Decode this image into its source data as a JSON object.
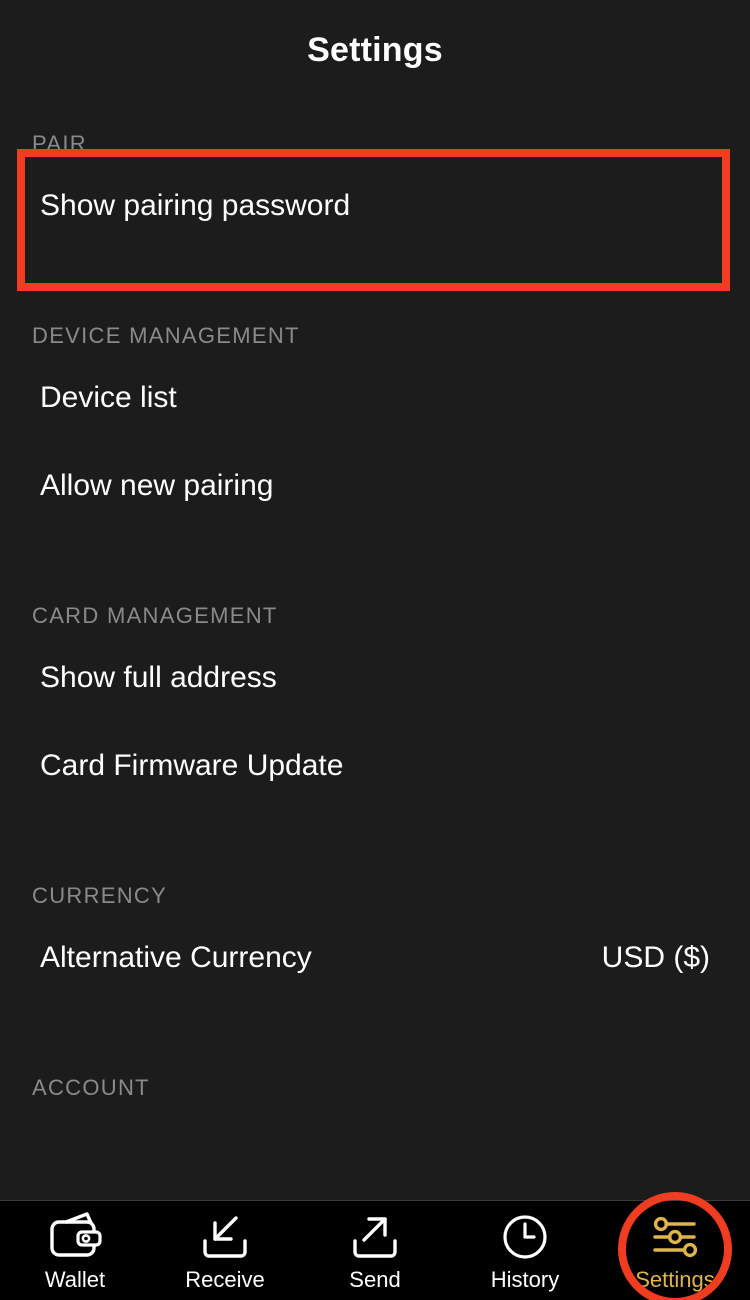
{
  "header": {
    "title": "Settings"
  },
  "sections": [
    {
      "id": "pair",
      "header": "PAIR",
      "rows": [
        {
          "id": "show-pairing-password",
          "label": "Show pairing password",
          "value": ""
        }
      ]
    },
    {
      "id": "device-management",
      "header": "DEVICE MANAGEMENT",
      "rows": [
        {
          "id": "device-list",
          "label": "Device list",
          "value": ""
        },
        {
          "id": "allow-new-pairing",
          "label": "Allow new pairing",
          "value": ""
        }
      ]
    },
    {
      "id": "card-management",
      "header": "CARD MANAGEMENT",
      "rows": [
        {
          "id": "show-full-address",
          "label": "Show full address",
          "value": ""
        },
        {
          "id": "card-firmware-update",
          "label": "Card Firmware Update",
          "value": ""
        }
      ]
    },
    {
      "id": "currency",
      "header": "CURRENCY",
      "rows": [
        {
          "id": "alternative-currency",
          "label": "Alternative Currency",
          "value": "USD ($)"
        }
      ]
    },
    {
      "id": "account",
      "header": "ACCOUNT",
      "rows": []
    }
  ],
  "tabbar": {
    "tabs": [
      {
        "id": "wallet",
        "label": "Wallet",
        "icon": "wallet-icon",
        "active": false
      },
      {
        "id": "receive",
        "label": "Receive",
        "icon": "receive-icon",
        "active": false
      },
      {
        "id": "send",
        "label": "Send",
        "icon": "send-icon",
        "active": false
      },
      {
        "id": "history",
        "label": "History",
        "icon": "clock-icon",
        "active": false
      },
      {
        "id": "settings",
        "label": "Settings",
        "icon": "sliders-icon",
        "active": true
      }
    ]
  },
  "annotations": {
    "box_color": "#f03c20",
    "circle_color": "#f03c20",
    "box_target": "PAIR section",
    "circle_target": "Settings tab"
  },
  "colors": {
    "background": "#1c1c1c",
    "tabbar_background": "#000000",
    "section_header": "#8a8a8a",
    "primary_text": "#ffffff",
    "accent": "#e0b44c",
    "annotation_red": "#f03c20"
  }
}
